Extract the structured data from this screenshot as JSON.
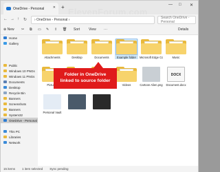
{
  "window": {
    "tab_title": "OneDrive - Personal",
    "watermark": "ElevenForum.com",
    "controls": [
      "—",
      "□",
      "✕"
    ]
  },
  "toolbar": {
    "address": "›  OneDrive - Personal  ›",
    "search_placeholder": "Search OneDrive - Personal"
  },
  "cmdbar": {
    "new_label": "⊕ New",
    "sort_label": "Sort",
    "view_label": "View",
    "more_label": "···",
    "details_label": "Details"
  },
  "sidebar": {
    "items": [
      {
        "label": "Home",
        "color": "#2b7bd3"
      },
      {
        "label": "Gallery",
        "color": "#3a9be6"
      },
      {
        "label": "",
        "color": "#f3f3f3"
      },
      {
        "label": "",
        "color": "#f3f3f3"
      },
      {
        "label": "",
        "color": "#f3f3f3"
      },
      {
        "label": "Public",
        "color": "#e9b93c"
      },
      {
        "label": "Windows 10 PNGs",
        "color": "#e9b93c"
      },
      {
        "label": "Windows 11 PNGs",
        "color": "#e9b93c"
      },
      {
        "label": "Documents",
        "color": "#5a7fb3"
      },
      {
        "label": "Desktop",
        "color": "#3a8ad8"
      },
      {
        "label": "Recycle Bin",
        "color": "#8aa5c4"
      },
      {
        "label": "Banners",
        "color": "#e9b93c"
      },
      {
        "label": "Screenshots",
        "color": "#e9b93c"
      },
      {
        "label": "Banners",
        "color": "#e9b93c"
      },
      {
        "label": "System32",
        "color": "#e9b93c"
      },
      {
        "label": "OneDrive - Personal",
        "color": "#2b7bd3"
      },
      {
        "label": "",
        "color": "#f3f3f3"
      },
      {
        "label": "This PC",
        "color": "#3a8ad8"
      },
      {
        "label": "Libraries",
        "color": "#e9b93c"
      },
      {
        "label": "Network",
        "color": "#3a8ad8"
      }
    ]
  },
  "files": [
    {
      "label": "Attachments",
      "kind": "folder"
    },
    {
      "label": "Desktop",
      "kind": "folder"
    },
    {
      "label": "Documents",
      "kind": "folder"
    },
    {
      "label": "Example folder",
      "kind": "folder"
    },
    {
      "label": "Microsoft Edge Collections",
      "kind": "folder"
    },
    {
      "label": "Music",
      "kind": "folder"
    },
    {
      "label": "Pictures",
      "kind": "folder"
    },
    {
      "label": "Public",
      "kind": "folder"
    },
    {
      "label": "Shared",
      "kind": "folder"
    },
    {
      "label": "Videos",
      "kind": "folder"
    },
    {
      "label": "Cartoon Alien.png",
      "kind": "image"
    },
    {
      "label": "Document.docx",
      "kind": "docx"
    },
    {
      "label": "Personal Vault",
      "kind": "vault"
    },
    {
      "label": "",
      "kind": "video"
    },
    {
      "label": "",
      "kind": "video2"
    }
  ],
  "callout": {
    "line1": "Folder in OneDrive",
    "line2": "linked to source folder"
  },
  "status": {
    "items_count": "15 items",
    "selected": "1 item selected",
    "sync": "Sync pending"
  }
}
